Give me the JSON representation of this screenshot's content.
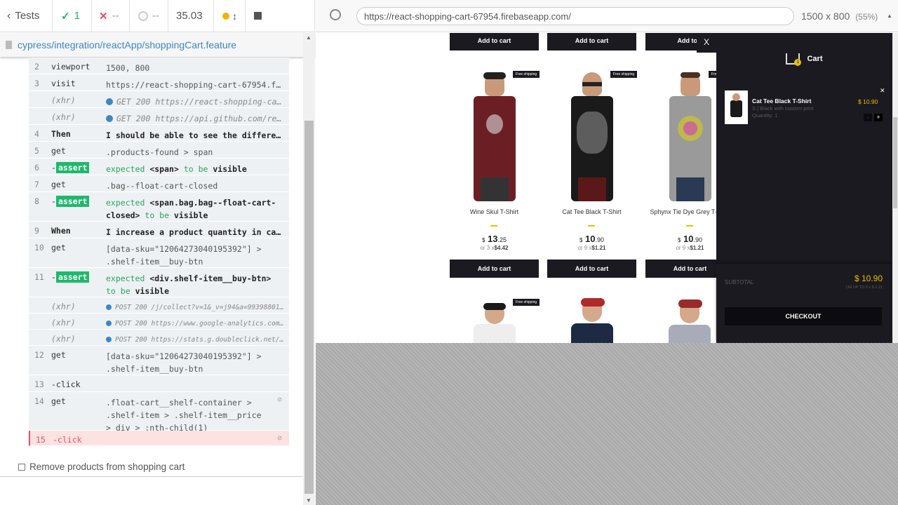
{
  "runner": {
    "tests_label": "Tests",
    "passed": "1",
    "failed": "--",
    "pending": "--",
    "duration": "35.03",
    "spec_path": "cypress/integration/reactApp/shoppingCart.feature",
    "next_test": "Remove products from shopping cart"
  },
  "commands": [
    {
      "num": "2",
      "cmd": "viewport",
      "msg": "1500, 800"
    },
    {
      "num": "3",
      "cmd": "visit",
      "msg": "https://react-shopping-cart-67954.fir..."
    },
    {
      "num": "",
      "cmd": "(xhr)",
      "msg": "GET 200 https://react-shopping-car..."
    },
    {
      "num": "",
      "cmd": "(xhr)",
      "msg": "GET 200 https://api.github.com/rep..."
    },
    {
      "num": "4",
      "cmd": "Then",
      "msg": "I should be able to see the different..."
    },
    {
      "num": "5",
      "cmd": "get",
      "msg": ".products-found > span"
    },
    {
      "num": "6",
      "cmd": "assert",
      "msg_a": "expected",
      "msg_b": "<span>",
      "msg_c": "to be",
      "msg_d": "visible"
    },
    {
      "num": "7",
      "cmd": "get",
      "msg": ".bag--float-cart-closed"
    },
    {
      "num": "8",
      "cmd": "assert",
      "msg_a": "expected",
      "msg_b": "<span.bag.bag--float-cart-closed>",
      "msg_c": "to be",
      "msg_d": "visible"
    },
    {
      "num": "9",
      "cmd": "When",
      "msg": "I increase a product quantity in cart"
    },
    {
      "num": "10",
      "cmd": "get",
      "msg": "[data-sku=\"12064273040195392\"] > .shelf-item__buy-btn"
    },
    {
      "num": "11",
      "cmd": "assert",
      "msg_a": "expected",
      "msg_b": "<div.shelf-item__buy-btn>",
      "msg_c": "to be",
      "msg_d": "visible"
    },
    {
      "num": "",
      "cmd": "(xhr)",
      "msg": "POST 200 /j/collect?v=1&_v=j94&a=99398801..."
    },
    {
      "num": "",
      "cmd": "(xhr)",
      "msg": "POST 200 https://www.google-analytics.com..."
    },
    {
      "num": "",
      "cmd": "(xhr)",
      "msg": "POST 200 https://stats.g.doubleclick.net/..."
    },
    {
      "num": "12",
      "cmd": "get",
      "msg": "[data-sku=\"12064273040195392\"] > .shelf-item__buy-btn"
    },
    {
      "num": "13",
      "cmd": "-click",
      "msg": ""
    },
    {
      "num": "14",
      "cmd": "get",
      "msg": ".float-cart__shelf-container > .shelf-item > .shelf-item__price > div > :nth-child(1)"
    },
    {
      "num": "15",
      "cmd": "-click",
      "msg": ""
    }
  ],
  "browser": {
    "url": "https://react-shopping-cart-67954.firebaseapp.com/",
    "viewport": "1500 x 800",
    "scale": "(55%)"
  },
  "shop": {
    "add_to_cart": "Add to cart",
    "add_to_cart_cut": "Add to c",
    "free_shipping": "Free shipping",
    "products": [
      {
        "title": "Wine Skul T-Shirt",
        "currency": "$",
        "price_int": "13",
        "price_dec": ".25",
        "installments": "or 3 x",
        "inst_value": "$4.42"
      },
      {
        "title": "Cat Tee Black T-Shirt",
        "currency": "$",
        "price_int": "10",
        "price_dec": ".90",
        "installments": "or 9 x",
        "inst_value": "$1.21"
      },
      {
        "title": "Sphynx Tie Dye Grey T-Shirt",
        "currency": "$",
        "price_int": "10",
        "price_dec": ".90",
        "installments": "or 9 x",
        "inst_value": "$1.21"
      }
    ],
    "cart": {
      "close": "X",
      "title": "Cart",
      "count": "1",
      "item_title": "Cat Tee Black T-Shirt",
      "item_desc": "S | Black with custom print",
      "item_qty": "Quantity: 1",
      "item_price": "$ 10.90",
      "minus": "-",
      "plus": "+",
      "subtotal_label": "SUBTOTAL",
      "subtotal_value": "$ 10.90",
      "subtotal_inst": "OR UP TO 9 x $ 1.21",
      "checkout": "CHECKOUT"
    }
  }
}
